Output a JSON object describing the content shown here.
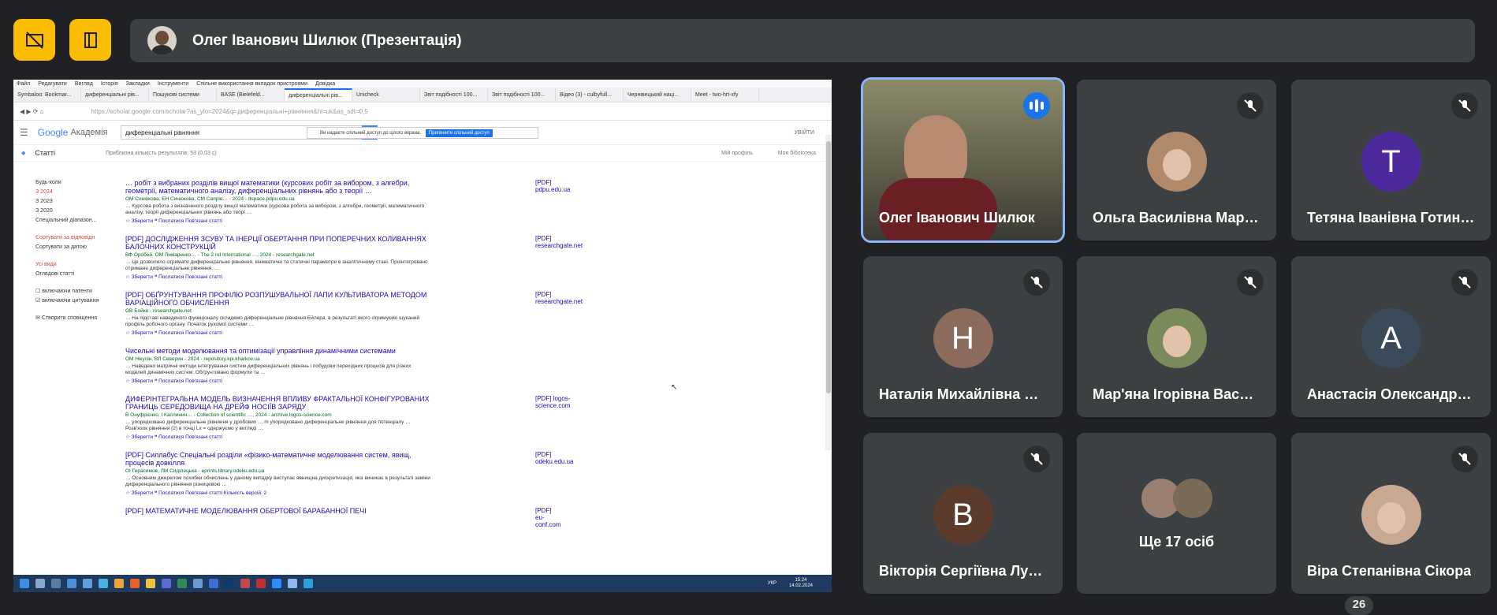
{
  "top": {
    "presenter_title": "Олег Іванович Шилюк (Презентація)"
  },
  "browser": {
    "menu": [
      "Файл",
      "Редагувати",
      "Вигляд",
      "Історія",
      "Закладки",
      "Інструменти",
      "Спільне використання вкладок пристроями",
      "Довідка"
    ],
    "tabs": [
      "Symbaloo: Bookmar...",
      "диференціальні рів...",
      "Пошукові системи",
      "BASE (Bielefeld...",
      "диференціальні рів...",
      "Unicheck",
      "Звіт подібності 100...",
      "Звіт подібності 100...",
      "Відео (3) - culbyfull...",
      "Чернівецький наці...",
      "Meet - two-hrt-xfy"
    ],
    "url": "https://scholar.google.com/scholar?as_ylo=2024&q=диференціальні+рівняння&hl=uk&as_sdt=0,5",
    "share_notice": "Ви надаєте спільний доступ до цілого екрана.",
    "share_button": "Припинити спільний доступ",
    "brand_google": "Google",
    "brand_academy": "Академія",
    "search_value": "диференціальні рівняння",
    "signin": "УВІЙТИ",
    "section": "Статті",
    "result_count": "Приблизна кількість результатів: 53 (0,03 с)",
    "my_profile": "Мій профіль",
    "my_library": "Моя бібліотека",
    "filters": {
      "any_time": "Будь-коли",
      "y2024": "З 2024",
      "y2023": "З 2023",
      "y2020": "З 2020",
      "custom": "Спеціальний діапазон...",
      "sort_relevance": "Сортувати за відповідн",
      "sort_date": "Сортувати за датою",
      "all_types": "Усі види",
      "reviews": "Оглядові статті",
      "patents": "включаючи патенти",
      "citations": "включаючи цитування",
      "alert": "Створити сповіщення"
    },
    "results": [
      {
        "title": "… робіт з вибраних розділів вищої математики (курсових робіт за вибором, з алгебри, геометрії, математичного аналізу, диференціальних рівнянь або з теорії …",
        "authors": "ОМ Синюкова, ЕН Синюкова, СМ Сапрін… - 2024 - dspace.pdpu.edu.ua",
        "snippet": "… Курсова робота з визначеного розділу вищої математики (курсова робота за вибором, з алгебри, геометрії, математичного аналізу, теорії диференціальних рівнянь або теорі …",
        "links": "☆ Зберегти   ❝ Послатися   Пов'язані статті",
        "side": "[PDF] pdpu.edu.ua"
      },
      {
        "title": "[PDF] ДОСЛІДЖЕННЯ ЗСУВУ ТА ІНЕРЦІЇ ОБЕРТАННЯ ПРИ ПОПЕРЕЧНИХ КОЛИВАННЯХ БАЛОЧНИХ КОНСТРУКЦІЙ",
        "authors": "ВФ Оробей, ОМ Лимаренко… - The 2 nd International …, 2024 - researchgate.net",
        "snippet": "… Це дозволило отримати диференціальне рівняння, кінематичні та статичні параметри в аналітичному стані. Проінтегровано отримане диференціальне рівняння, …",
        "links": "☆ Зберегти   ❝ Послатися   Пов'язані статті",
        "side": "[PDF] researchgate.net"
      },
      {
        "title": "[PDF] ОБҐРУНТУВАННЯ ПРОФІЛЮ РОЗПУШУВАЛЬНОЇ ЛАПИ КУЛЬТИВАТОРА МЕТОДОМ ВАРІАЦІЙНОГО ОБЧИСЛЕННЯ",
        "authors": "ОВ Бойко - researchgate.net",
        "snippet": "… На підставі наведеного функціоналу складемо диференціальне рівняння Ейлера, в результаті якого отримуємо шуканий профіль робочого органу. Початок рухомої системи …",
        "links": "☆ Зберегти   ❝ Послатися   Пов'язані статті",
        "side": "[PDF] researchgate.net"
      },
      {
        "title": "Чисельні методи моделювання та оптимізації управління динамічними системами",
        "authors": "ОМ Нікулін, ВЛ Северин - 2024 - repository.kpi.kharkov.ua",
        "snippet": "… Наведено матричні методи інтегрування систем диференціальних рівнянь і побудови перехідних процесів для різних моделей динамічних систем. Обґрунтовано формули та …",
        "links": "☆ Зберегти   ❝ Послатися   Пов'язані статті",
        "side": ""
      },
      {
        "title": "ДИФЕРІНТЕГРАЛЬНА МОДЕЛЬ ВИЗНАЧЕННЯ ВПЛИВУ ФРАКТАЛЬНОЇ КОНФІГУРОВАНИХ ГРАНИЦЬ СЕРЕДОВИЩА НА ДРЕЙФ НОСІЇВ ЗАРЯДУ",
        "authors": "В Онуфрієнко, І Каплинин… - Collection of scientific …, 2024 - archive.logos-science.com",
        "snippet": "… упорядковано диференціальне рівняння у дробових … m упорядковано диференціальне рівняння для потенціалу … Розв'язок рівняння (2) в точці Lx = одержуємо у вигляді …",
        "links": "☆ Зберегти   ❝ Послатися   Пов'язані статті",
        "side": "[PDF] logos-science.com"
      },
      {
        "title": "[PDF] Силлабус Спеціальні розділи «фізико-математичне моделювання систем, явищ, процесів довкілля",
        "authors": "ОІ Герасимов, ЛМ Сиділецька - eprints.library.odeku.edu.ua",
        "snippet": "… Основним джерелом похибки обчислень у даному випадку виступає явнищна дискретизація, яка виникає в результаті заміни диференціального рівняння різницевою …",
        "links": "☆ Зберегти   ❝ Послатися   Пов'язані статті   Кількість версій: 2",
        "side": "[PDF] odeku.edu.ua"
      },
      {
        "title": "[PDF] МАТЕМАТИЧНЕ МОДЕЛЮВАННЯ ОБЕРТОВОЇ БАРАБАННОЇ ПЕЧІ",
        "authors": "",
        "snippet": "",
        "links": "",
        "side": "[PDF] eu-conf.com"
      }
    ],
    "clock_time": "15:24",
    "clock_date": "14.02.2024",
    "lang": "УКР"
  },
  "participants": [
    {
      "name": "Олег Іванович Шилюк",
      "type": "video",
      "speaking": true
    },
    {
      "name": "Ольга Василівна Мар…",
      "type": "photo",
      "muted": true,
      "color": "#b08a6a"
    },
    {
      "name": "Тетяна Іванівна Готин…",
      "type": "letter",
      "letter": "Т",
      "muted": true,
      "color": "#4c2a9e"
    },
    {
      "name": "Наталія Михайлівна …",
      "type": "letter",
      "letter": "Н",
      "muted": true,
      "color": "#8c6a5c"
    },
    {
      "name": "Мар'яна Ігорівна Вас…",
      "type": "photo",
      "muted": true,
      "color": "#7a8a5a"
    },
    {
      "name": "Анастасія Олександр…",
      "type": "letter",
      "letter": "А",
      "muted": true,
      "color": "#3b4a58"
    },
    {
      "name": "Вікторія Сергіївна Лу…",
      "type": "letter",
      "letter": "В",
      "muted": true,
      "color": "#5c3a2c"
    },
    {
      "name": "Ще 17 осіб",
      "type": "group"
    },
    {
      "name": "Віра Степанівна Сікора",
      "type": "photo",
      "muted": true,
      "color": "#c8a890"
    }
  ],
  "participant_count": "26"
}
